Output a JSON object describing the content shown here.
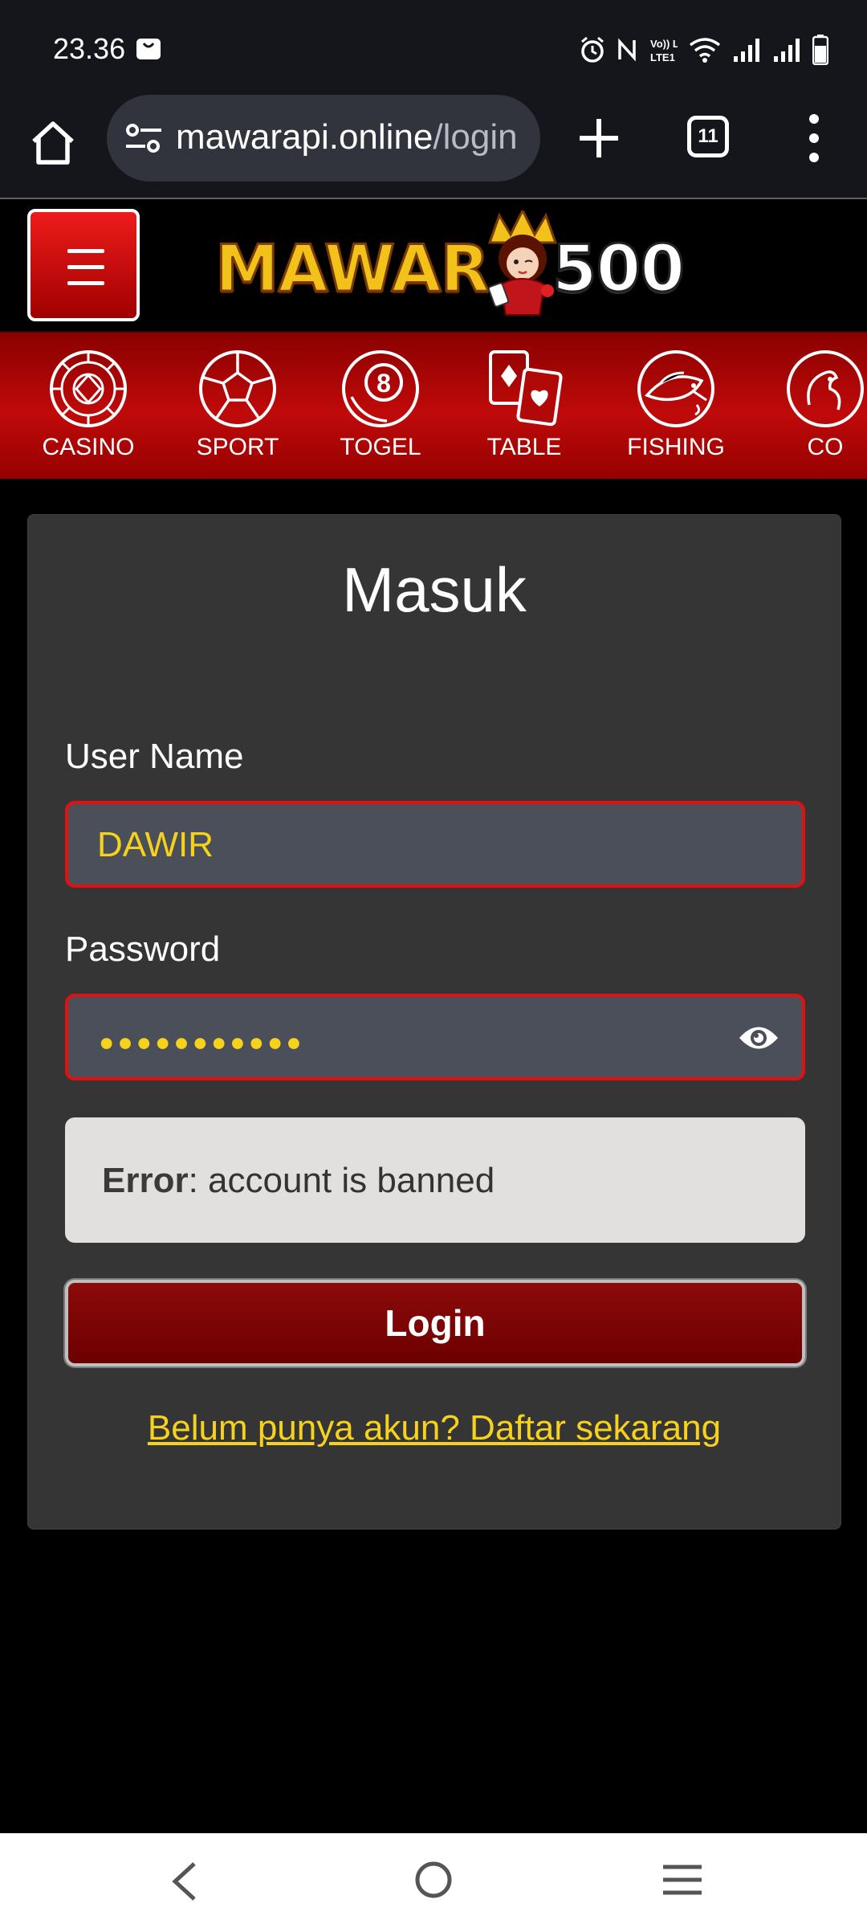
{
  "status_bar": {
    "time": "23.36",
    "icons": [
      "shopping-bag-icon",
      "alarm-icon",
      "nfc-icon",
      "volte-icon",
      "wifi-icon",
      "signal-icon",
      "signal-icon",
      "battery-icon"
    ],
    "volte_label": "Vo)) LTE1"
  },
  "browser": {
    "url_domain": "mawarapi.online",
    "url_path": "/login",
    "tab_count": "11"
  },
  "site": {
    "logo_left": "MAWAR",
    "logo_right": "500",
    "brand_color": "#c00a0a"
  },
  "categories": [
    {
      "label": "CASINO",
      "icon": "roulette-icon"
    },
    {
      "label": "SPORT",
      "icon": "soccer-ball-icon"
    },
    {
      "label": "TOGEL",
      "icon": "eight-ball-icon"
    },
    {
      "label": "TABLE",
      "icon": "playing-cards-icon"
    },
    {
      "label": "FISHING",
      "icon": "fish-icon"
    },
    {
      "label": "CO",
      "icon": "cockfight-icon"
    }
  ],
  "login": {
    "title": "Masuk",
    "username_label": "User Name",
    "username_value": "DAWIR",
    "password_label": "Password",
    "password_masked": "●●●●●●●●●●●",
    "error_prefix": "Error",
    "error_message": ": account is banned",
    "login_button": "Login",
    "register_link": "Belum punya akun? Daftar sekarang"
  }
}
